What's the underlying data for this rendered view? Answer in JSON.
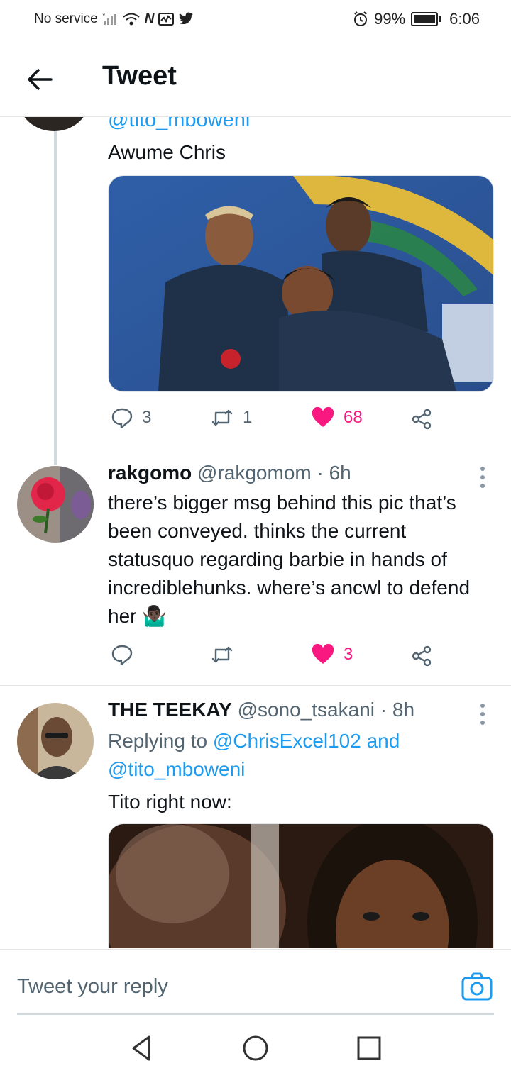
{
  "status_bar": {
    "carrier": "No service",
    "network_icons": [
      "signal-off-icon",
      "wifi-icon",
      "nfc-icon",
      "activity-icon",
      "twitter-icon"
    ],
    "alarm_icon": "alarm-icon",
    "battery_percent": "99%",
    "time": "6:06"
  },
  "header": {
    "title": "Tweet",
    "back_icon": "arrow-left-icon"
  },
  "tweets": [
    {
      "handle_partial": "@tito_mboweni",
      "text": "Awume Chris",
      "media_alt": "photo-football-players-laughing",
      "actions": {
        "replies": "3",
        "retweets": "1",
        "likes": "68",
        "liked": true
      }
    },
    {
      "name": "rakgomo",
      "handle": "@rakgomom",
      "time": "· 6h",
      "text": "there’s bigger msg behind this pic that’s been conveyed. thinks the current statusquo regarding barbie in hands of incrediblehunks. where’s ancwl to defend her 🤷🏿‍♂️",
      "actions": {
        "replies": "",
        "retweets": "",
        "likes": "3",
        "liked": true
      }
    },
    {
      "name": "THE TEEKAY",
      "handle": "@sono_tsakani",
      "time": "· 8h",
      "replying_prefix": "Replying to",
      "replying_user1": "@ChrisExcel102",
      "replying_and": "and",
      "replying_user2": "@tito_mboweni",
      "text": "Tito right now:",
      "media_alt": "photo-movie-still"
    }
  ],
  "reply_bar": {
    "placeholder": "Tweet your reply",
    "camera_icon": "camera-icon"
  },
  "nav_bar": {
    "back": "triangle-back-icon",
    "home": "circle-home-icon",
    "recents": "square-recents-icon"
  },
  "colors": {
    "accent": "#1d9bf0",
    "like": "#f91880",
    "text": "#0f1419",
    "muted": "#536471"
  }
}
